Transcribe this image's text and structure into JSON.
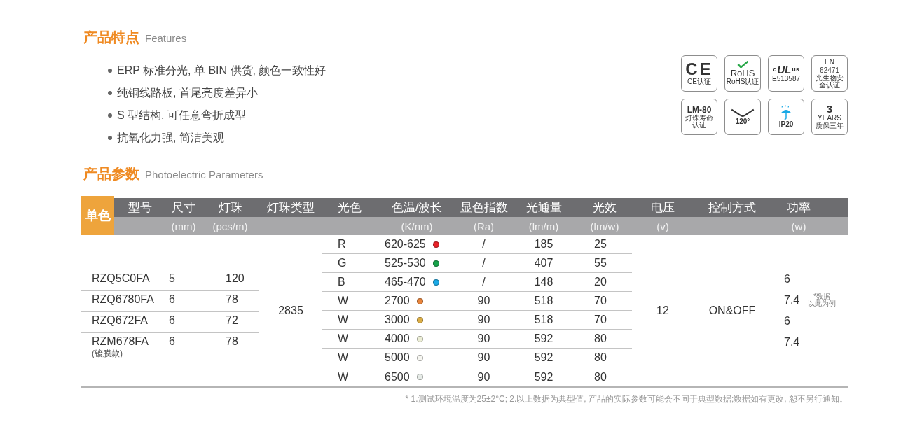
{
  "features": {
    "title": "产品特点",
    "subtitle": "Features",
    "items": [
      "ERP 标准分光, 单 BIN 供货, 颜色一致性好",
      "纯铜线路板, 首尾亮度差异小",
      "S 型结构, 可任意弯折成型",
      "抗氧化力强, 简洁美观"
    ]
  },
  "certifications": [
    {
      "kind": "ce",
      "mark": "CE",
      "caption": "CE认证"
    },
    {
      "kind": "rohs",
      "mark": "RoHS",
      "caption": "RoHS认证"
    },
    {
      "kind": "ul",
      "prefix": "c",
      "mark": "UL",
      "suffix": "us",
      "caption": "E513587"
    },
    {
      "kind": "en",
      "mark": "EN",
      "number": "62471",
      "caption": "光生物安全认证"
    },
    {
      "kind": "lm80",
      "mark": "LM-80",
      "caption": "灯珠寿命认证"
    },
    {
      "kind": "angle",
      "caption": "120°"
    },
    {
      "kind": "ip",
      "caption": "IP20"
    },
    {
      "kind": "warranty",
      "mark": "3",
      "unit": "YEARS",
      "caption": "质保三年"
    }
  ],
  "parameters": {
    "title": "产品参数",
    "subtitle": "Photoelectric Parameters",
    "table": {
      "corner": "单色",
      "columns": [
        {
          "label": "型号"
        },
        {
          "label": "尺寸",
          "unit": "(mm)"
        },
        {
          "label": "灯珠",
          "unit": "(pcs/m)"
        },
        {
          "label": "灯珠类型"
        },
        {
          "label": "光色"
        },
        {
          "label": "色温/波长",
          "unit": "(K/nm)"
        },
        {
          "label": "显色指数",
          "unit": "(Ra)"
        },
        {
          "label": "光通量",
          "unit": "(lm/m)"
        },
        {
          "label": "光效",
          "unit": "(lm/w)"
        },
        {
          "label": "电压",
          "unit": "(v)"
        },
        {
          "label": "控制方式"
        },
        {
          "label": "功率",
          "unit": "(w)"
        }
      ],
      "models": [
        {
          "model": "RZQ5C0FA",
          "size": "5",
          "density": "120"
        },
        {
          "model": "RZQ6780FA",
          "size": "6",
          "density": "78"
        },
        {
          "model": "RZQ672FA",
          "size": "6",
          "density": "72"
        },
        {
          "model": "RZM678FA",
          "note": "(镀膜款)",
          "size": "6",
          "density": "78"
        }
      ],
      "led_type": "2835",
      "colors": [
        {
          "light": "R",
          "temperature": "620-625",
          "color": "#e82128",
          "ra": "/",
          "flux": "185",
          "efficacy": "25"
        },
        {
          "light": "G",
          "temperature": "525-530",
          "color": "#17a34a",
          "ra": "/",
          "flux": "407",
          "efficacy": "55"
        },
        {
          "light": "B",
          "temperature": "465-470",
          "color": "#1aa9e6",
          "ra": "/",
          "flux": "148",
          "efficacy": "20"
        },
        {
          "light": "W",
          "temperature": "2700",
          "color": "#e9853c",
          "ra": "90",
          "flux": "518",
          "efficacy": "70"
        },
        {
          "light": "W",
          "temperature": "3000",
          "color": "#dcae45",
          "ra": "90",
          "flux": "518",
          "efficacy": "70"
        },
        {
          "light": "W",
          "temperature": "4000",
          "color": "#eceed6",
          "ra": "90",
          "flux": "592",
          "efficacy": "80"
        },
        {
          "light": "W",
          "temperature": "5000",
          "color": "#f6f6f1",
          "ra": "90",
          "flux": "592",
          "efficacy": "80"
        },
        {
          "light": "W",
          "temperature": "6500",
          "color": "#e6ebe7",
          "ra": "90",
          "flux": "592",
          "efficacy": "80"
        }
      ],
      "voltage": "12",
      "control": "ON&OFF",
      "power": [
        {
          "value": "6"
        },
        {
          "value": "7.4",
          "note": [
            "*数据",
            "以此为例"
          ]
        },
        {
          "value": "6"
        },
        {
          "value": "7.4"
        }
      ]
    }
  },
  "footnote": "* 1.测试环境温度为25±2°C;  2.以上数据为典型值, 产品的实际参数可能会不同于典型数据;数据如有更改, 恕不另行通知。"
}
